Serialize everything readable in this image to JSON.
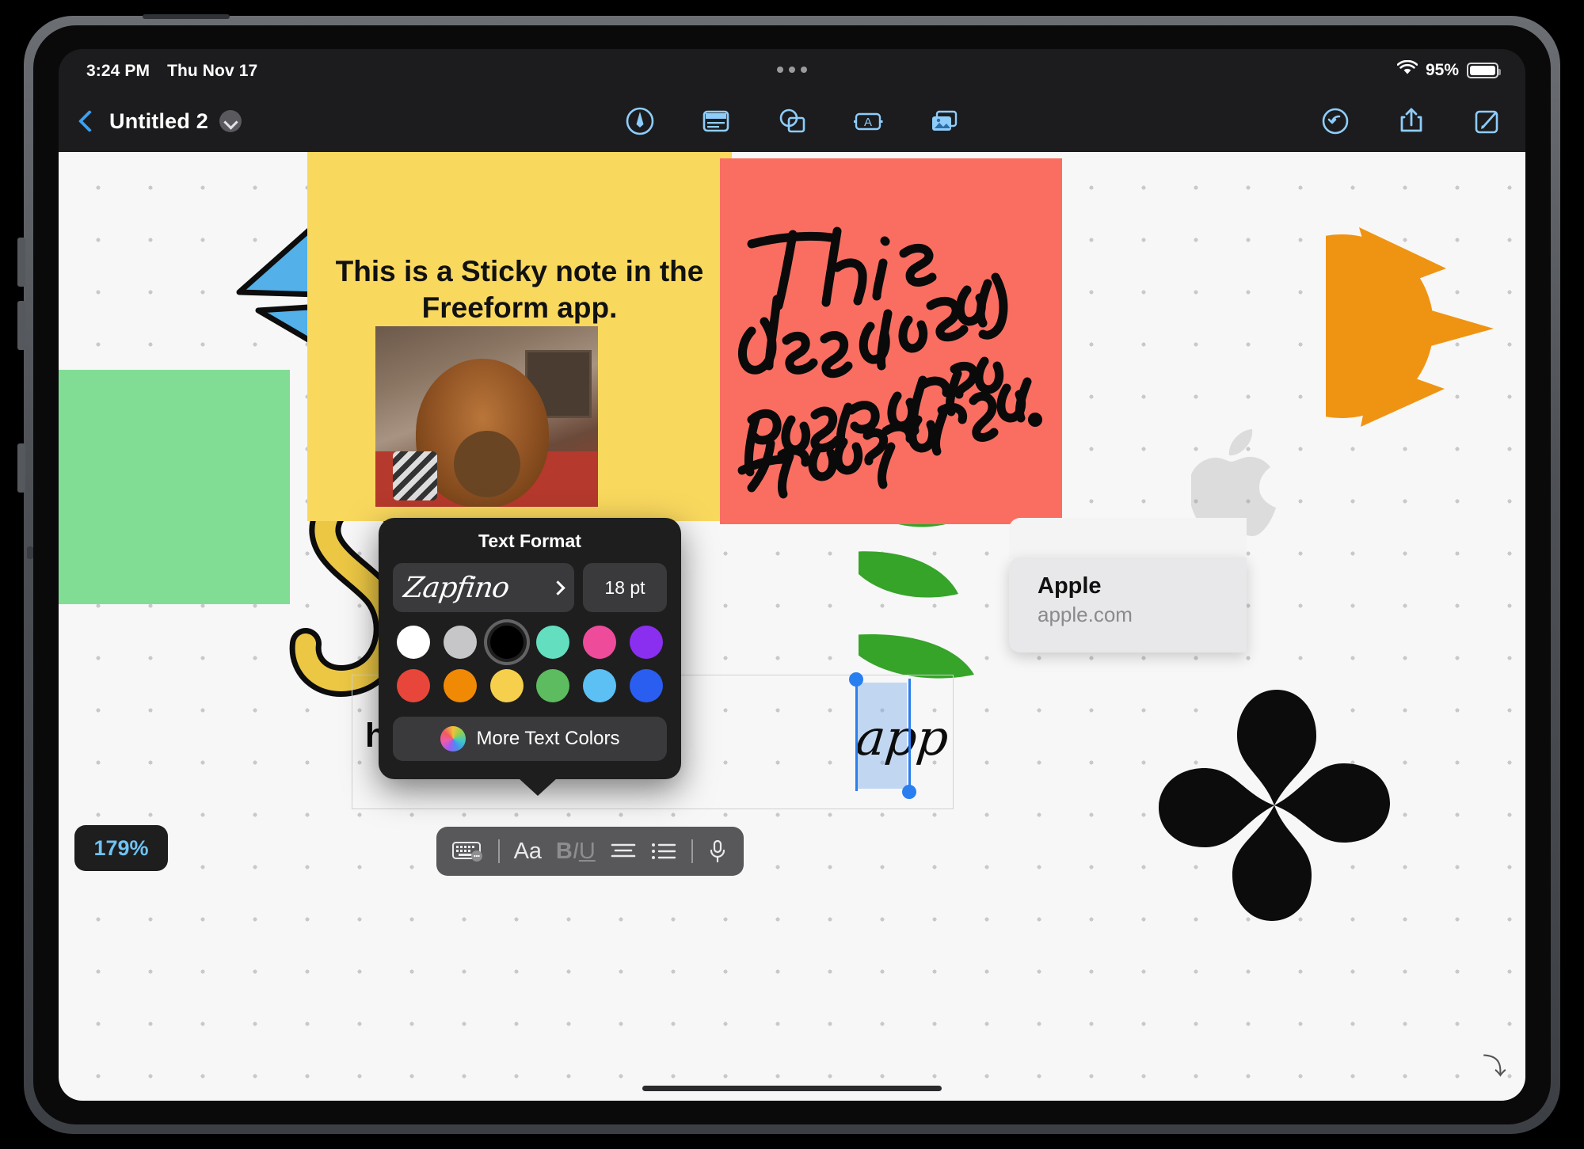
{
  "status_bar": {
    "time": "3:24 PM",
    "date": "Thu Nov 17",
    "battery_percent": "95%",
    "wifi_icon": "wifi-icon",
    "battery_icon": "battery-icon"
  },
  "navbar": {
    "back_icon": "back-chevron-icon",
    "document_title": "Untitled 2",
    "title_menu_icon": "chevron-down-icon",
    "tools": [
      {
        "name": "pen-tool",
        "icon": "pen-in-circle-icon"
      },
      {
        "name": "sticky-note-tool",
        "icon": "sticky-note-icon"
      },
      {
        "name": "shapes-tool",
        "icon": "shapes-icon"
      },
      {
        "name": "text-box-tool",
        "icon": "text-box-icon"
      },
      {
        "name": "media-tool",
        "icon": "photo-stack-icon"
      }
    ],
    "actions": [
      {
        "name": "undo-button",
        "icon": "undo-circle-icon"
      },
      {
        "name": "share-button",
        "icon": "share-icon"
      },
      {
        "name": "compose-button",
        "icon": "compose-icon"
      }
    ]
  },
  "canvas": {
    "zoom_level": "179%",
    "yellow_sticky_note": "This is a Sticky note in the Freeform app.",
    "red_sticky_note_handwriting": "This is also a sticky note in the freeform app.",
    "green_sticky_note": "",
    "text_object": {
      "visible_text": "he Freeform",
      "selected_word": "app"
    },
    "link_card": {
      "title": "Apple",
      "url": "apple.com"
    },
    "shapes": [
      {
        "name": "blue-paper-plane-shape",
        "color": "#53b0e8"
      },
      {
        "name": "yellow-s-shape",
        "color": "#ecc744"
      },
      {
        "name": "green-leaves-shape",
        "color": "#35a429"
      },
      {
        "name": "orange-sun-shape",
        "color": "#ef9412"
      },
      {
        "name": "black-clover-shape",
        "color": "#0c0c0c"
      },
      {
        "name": "apple-logo-watermark",
        "color": "#9a9a9e"
      }
    ],
    "photo_thumbnail": "lion-costume-photo"
  },
  "text_format_popover": {
    "title": "Text Format",
    "font_name": "Zapfino",
    "font_chevron_icon": "chevron-right-icon",
    "font_size": "18 pt",
    "colors_row1": [
      {
        "name": "white",
        "hex": "#ffffff",
        "selected": false
      },
      {
        "name": "gray",
        "hex": "#c6c6c8",
        "selected": false
      },
      {
        "name": "black",
        "hex": "#000000",
        "selected": true
      },
      {
        "name": "mint",
        "hex": "#63dfc0",
        "selected": false
      },
      {
        "name": "pink",
        "hex": "#ee4c9b",
        "selected": false
      },
      {
        "name": "purple",
        "hex": "#8a2ff0",
        "selected": false
      }
    ],
    "colors_row2": [
      {
        "name": "red",
        "hex": "#e8463a",
        "selected": false
      },
      {
        "name": "orange",
        "hex": "#f08a05",
        "selected": false
      },
      {
        "name": "yellow",
        "hex": "#f6d04c",
        "selected": false
      },
      {
        "name": "green",
        "hex": "#5cbc5f",
        "selected": false
      },
      {
        "name": "light-blue",
        "hex": "#5cc0f5",
        "selected": false
      },
      {
        "name": "blue",
        "hex": "#2a5ef0",
        "selected": false
      }
    ],
    "more_colors_label": "More Text Colors",
    "color_wheel_icon": "color-wheel-icon"
  },
  "format_toolbar": {
    "items": [
      {
        "name": "keyboard-button",
        "icon": "keyboard-icon"
      },
      {
        "name": "divider-1",
        "icon": "vertical-divider"
      },
      {
        "name": "font-style-button",
        "icon": "Aa"
      },
      {
        "name": "bold-italic-underline-button",
        "icon": "BIU"
      },
      {
        "name": "align-button",
        "icon": "align-left-icon"
      },
      {
        "name": "list-button",
        "icon": "bullet-list-icon"
      },
      {
        "name": "divider-2",
        "icon": "vertical-divider"
      },
      {
        "name": "dictation-button",
        "icon": "microphone-icon"
      }
    ]
  }
}
